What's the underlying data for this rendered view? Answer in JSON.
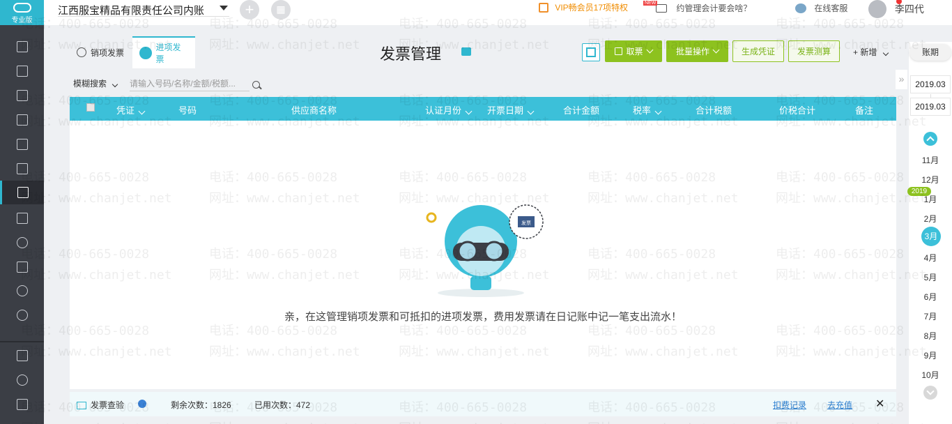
{
  "app": {
    "logo_label": "专业版",
    "company": "江西服宝精品有限责任公司内账",
    "vip_text": "VIP畅会员17项特权",
    "promo_badge": "NEW",
    "promo_text": "约管理会计要会啥？",
    "online_service": "在线客服",
    "user_name": "李四代"
  },
  "tabs": [
    {
      "label": "销项发票",
      "active": false
    },
    {
      "label": "进项发票",
      "active": true
    }
  ],
  "page_title": "发票管理",
  "toolbar": {
    "take_ticket": "取票",
    "batch_ops": "批量操作",
    "gen_voucher": "生成凭证",
    "invoice_calc": "发票测算",
    "add": "新增",
    "ledger": "账期"
  },
  "search": {
    "mode": "模糊搜索",
    "placeholder": "请输入号码/名称/金额/税额..."
  },
  "table": {
    "headers": [
      "凭证",
      "号码",
      "供应商名称",
      "认证月份",
      "开票日期",
      "合计金额",
      "税率",
      "合计税额",
      "价税合计",
      "备注"
    ]
  },
  "empty": {
    "art_label": "发票",
    "message": "亲，在这管理销项发票和可抵扣的进项发票，费用发票请在日记账中记一笔支出流水！"
  },
  "footer": {
    "check_label": "发票查验",
    "remaining": "剩余次数：1826",
    "used": "已用次数：472",
    "deduct_record": "扣费记录",
    "recharge": "去充值",
    "close": "✕"
  },
  "ledger": {
    "period_from": "2019.03",
    "period_to": "2019.03",
    "year_badge": "2019",
    "months": [
      "11月",
      "12月",
      "1月",
      "2月",
      "3月",
      "4月",
      "5月",
      "6月",
      "7月",
      "8月",
      "9月",
      "10月"
    ],
    "selected_month": "3月"
  },
  "watermark": {
    "phone": "电话：400-665-0028",
    "site": "网址：www.chanjet.net"
  },
  "colors": {
    "accent": "#3cc0d9",
    "green": "#8dc21f",
    "sidebar": "#3b3e45",
    "vip": "#f08c00"
  }
}
